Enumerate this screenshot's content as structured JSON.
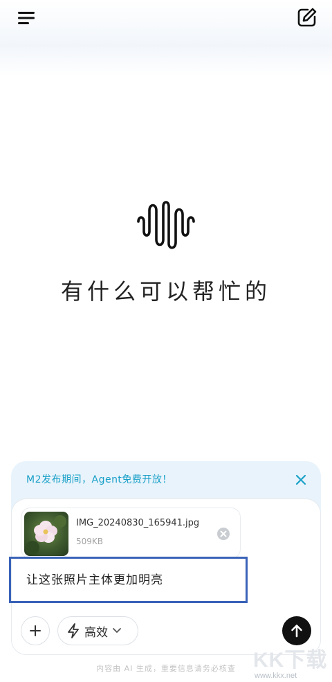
{
  "header": {
    "menu_icon": "menu-icon",
    "new_chat_icon": "edit-icon"
  },
  "main": {
    "logo_icon": "sound-wave-logo",
    "welcome_text": "有什么可以帮忙的"
  },
  "promo": {
    "text": "M2发布期间，Agent免费开放！",
    "close_icon": "close-icon",
    "color": "#1aa0c8"
  },
  "composer": {
    "attachment": {
      "file_name": "IMG_20240830_165941.jpg",
      "file_size": "509KB",
      "remove_icon": "remove-icon"
    },
    "input_text": "让这张照片主体更加明亮",
    "plus_icon": "plus-icon",
    "mode": {
      "icon": "lightning-icon",
      "label": "高效",
      "chevron": "chevron-down-icon"
    },
    "send_icon": "arrow-up-icon"
  },
  "footer": {
    "disclaimer": "内容由 AI 生成，重要信息请务必核查"
  },
  "watermark": {
    "text": "KK下载",
    "url": "www.kkx.net"
  },
  "colors": {
    "accent": "#1aa0c8",
    "highlight_border": "#3a63b8",
    "send_button": "#111111"
  }
}
